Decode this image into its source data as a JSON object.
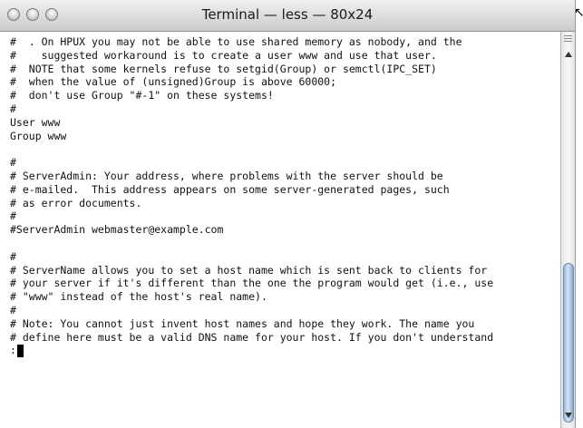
{
  "window": {
    "title": "Terminal — less — 80x24"
  },
  "terminal": {
    "lines": [
      "#  . On HPUX you may not be able to use shared memory as nobody, and the",
      "#    suggested workaround is to create a user www and use that user.",
      "#  NOTE that some kernels refuse to setgid(Group) or semctl(IPC_SET)",
      "#  when the value of (unsigned)Group is above 60000;",
      "#  don't use Group \"#-1\" on these systems!",
      "#",
      "User www",
      "Group www",
      "",
      "#",
      "# ServerAdmin: Your address, where problems with the server should be",
      "# e-mailed.  This address appears on some server-generated pages, such",
      "# as error documents.",
      "#",
      "#ServerAdmin webmaster@example.com",
      "",
      "#",
      "# ServerName allows you to set a host name which is sent back to clients for",
      "# your server if it's different than the one the program would get (i.e., use",
      "# \"www\" instead of the host's real name).",
      "#",
      "# Note: You cannot just invent host names and hope they work. The name you",
      "# define here must be a valid DNS name for your host. If you don't understand"
    ],
    "prompt": ":"
  },
  "icons": {
    "close": "close-icon",
    "minimize": "minimize-icon",
    "zoom": "zoom-icon",
    "scroll_up": "arrow-up-icon",
    "scroll_down": "arrow-down-icon",
    "pointer": "mouse-pointer-icon"
  },
  "colors": {
    "text": "#111111",
    "background": "#ffffff",
    "scroll_thumb": "#9bb8dc"
  }
}
